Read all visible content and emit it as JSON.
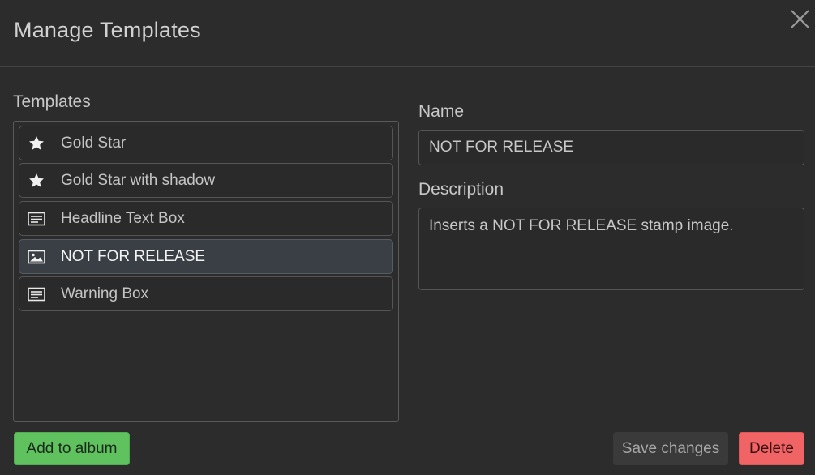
{
  "dialog": {
    "title": "Manage Templates",
    "close_icon": "close-icon"
  },
  "templates_section": {
    "label": "Templates",
    "items": [
      {
        "label": "Gold Star",
        "icon": "star-icon",
        "selected": false
      },
      {
        "label": "Gold Star with shadow",
        "icon": "star-icon",
        "selected": false
      },
      {
        "label": "Headline Text Box",
        "icon": "text-box-icon",
        "selected": false
      },
      {
        "label": "NOT FOR RELEASE",
        "icon": "image-icon",
        "selected": true
      },
      {
        "label": "Warning Box",
        "icon": "text-box-icon",
        "selected": false
      }
    ]
  },
  "details": {
    "name_label": "Name",
    "name_value": "NOT FOR RELEASE",
    "description_label": "Description",
    "description_value": "Inserts a NOT FOR RELEASE stamp image."
  },
  "buttons": {
    "add_label": "Add to album",
    "save_label": "Save changes",
    "delete_label": "Delete"
  },
  "colors": {
    "background": "#2c2c2c",
    "selected_item": "#3a3f45",
    "add_button": "#5fc25f",
    "delete_button": "#f06465"
  }
}
